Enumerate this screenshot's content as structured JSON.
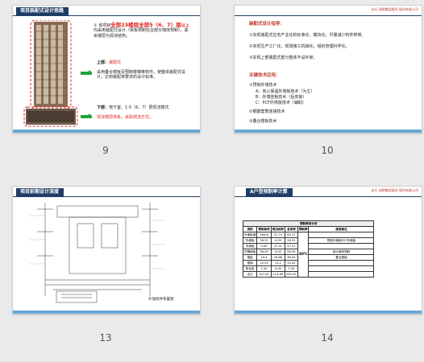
{
  "slides": [
    {
      "number": "9",
      "title": "项目装配式设计思路",
      "para1_pre": "① 该项目",
      "para1_red": "全部23楼层全部5（6、7）层",
      "para1_red2": "以上",
      "para1_post": "均采用装配式设计（梁板预制柱及部分墙体预制），其余楼层为现浇结构。",
      "upper_label": "上部：",
      "upper_red": "装配式",
      "upper_text": "采用叠合楼板及预制楼梯等构件，使整体装配式设计，达到装配率要求的设计标准。",
      "lower_label": "下部：",
      "lower_text": "地下室、1-5（6、7）层现浇楼式",
      "lower_red": "现浇楼层体系，采取现浇方式。"
    },
    {
      "number": "10",
      "title": "",
      "heading": "装配式设计指导：",
      "items": [
        "①实现装配式住宅产业化的标准化、模块化，尽量减少构件种类。",
        "②实现生产工厂化，现场施工机械化，组织管理科学化。",
        "③实现上部装配式部分整体不设外架。"
      ],
      "tech_heading": "关键技术应用：",
      "tech_items": [
        "①预制外墙技术",
        "A：夹心保温外墙板技术（为主）",
        "B：外墙挂板技术（后安装）",
        "C：PCF外墙板技术（辅助）",
        "②钢筋套筒连接技术",
        "③叠合楼板技术"
      ]
    },
    {
      "number": "13",
      "title": "项目前期设计深度",
      "caption": "外墙构件布置图"
    },
    {
      "number": "14",
      "title": "A户型预制率计算",
      "table_title": "预制率统计表",
      "headers": [
        "类别",
        "预制体积",
        "现浇体积",
        "总体积",
        "预制率",
        "使用部位"
      ],
      "rows": [
        [
          "外墙板墙",
          "264.8",
          "57.74",
          "83.17",
          ""
        ],
        [
          "外墙板",
          "26.31",
          "0.00",
          "26.31",
          "预制外墙板PCF外墙板"
        ],
        [
          "内墙板",
          "0.00",
          "47.21",
          "47.21",
          ""
        ],
        [
          "内隔墙板",
          "56.59",
          "0.00",
          "56.59",
          "部分墙体预制"
        ],
        [
          "楼板",
          "19.4",
          "16.88",
          "36.40",
          "叠合楼板"
        ],
        [
          "楼梯",
          "10.03",
          "15.2",
          "15.02",
          ""
        ],
        [
          "阳台板",
          "1.50",
          "0.00",
          "1.39",
          ""
        ],
        [
          "合计",
          "157.42",
          "123.60",
          "281.02",
          ""
        ]
      ],
      "rate": "48%"
    }
  ],
  "header_logo_text": "永升 旭辉集团股份 股份有限公司",
  "colors": {
    "header_bg": "#1f3e66",
    "footer_bar": "#6aa9d6",
    "accent_red": "#e02020",
    "arrow_green": "#1fa33a"
  }
}
